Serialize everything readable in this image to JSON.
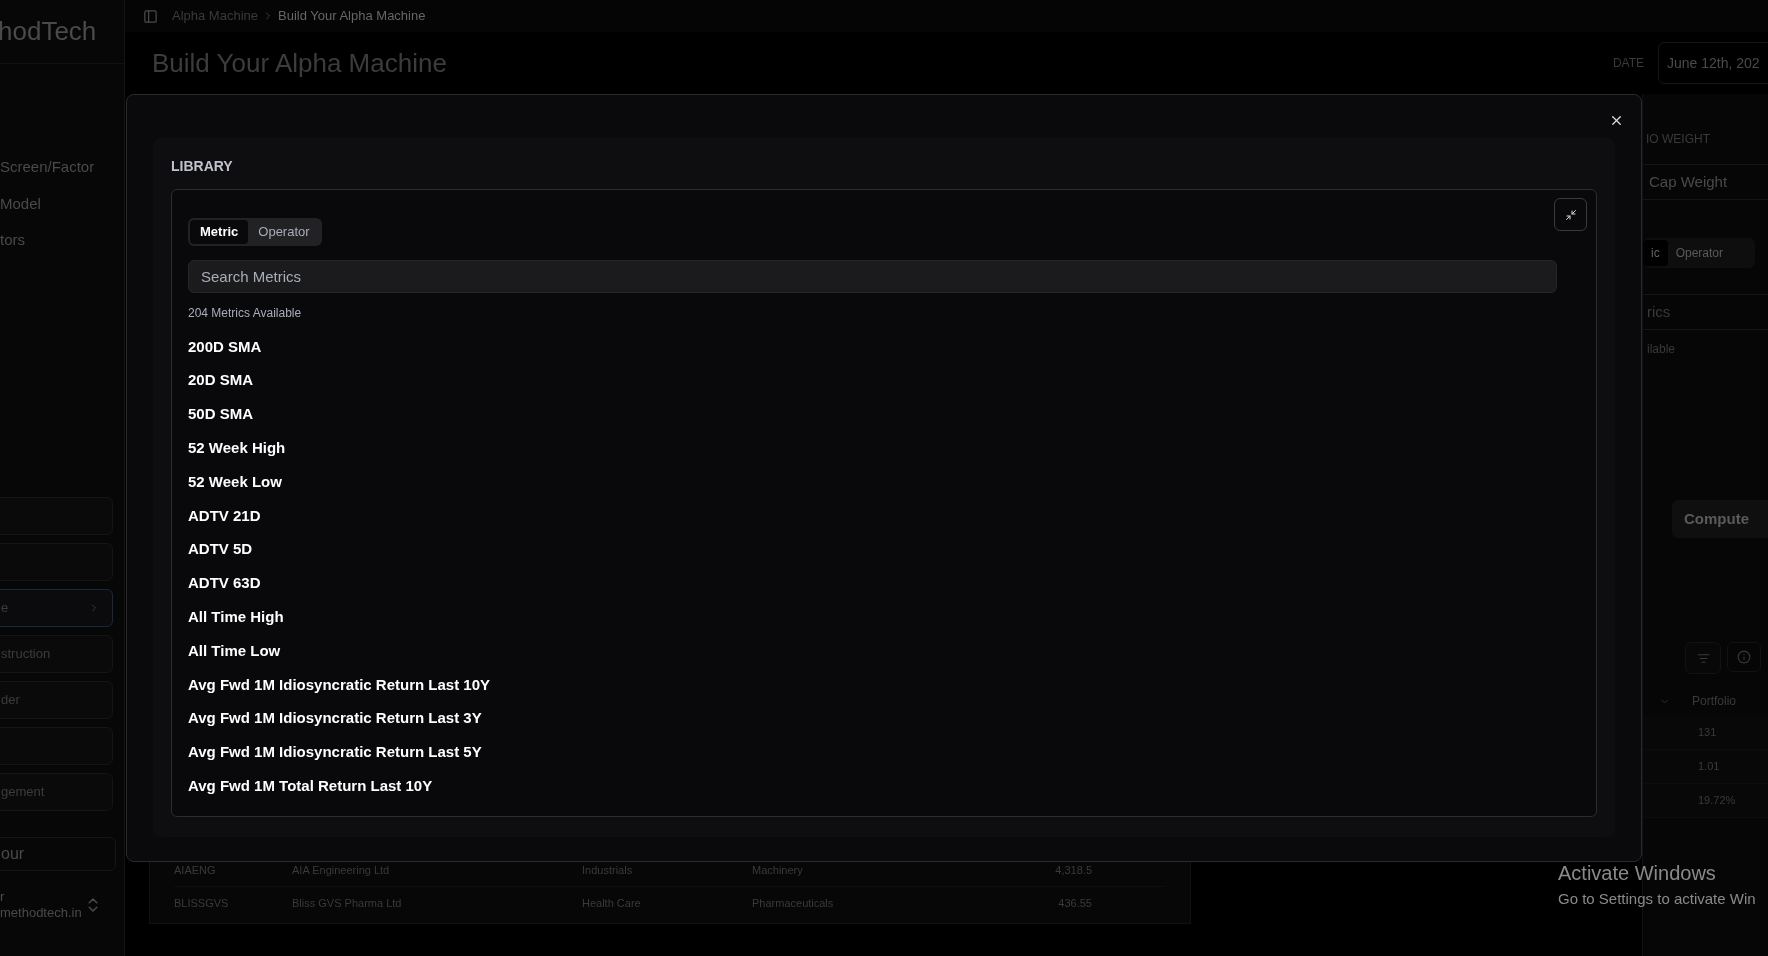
{
  "sidebar": {
    "logo": "hodTech",
    "nav": [
      {
        "label": "Screen/Factor"
      },
      {
        "label": "Model"
      },
      {
        "label": "tors"
      }
    ],
    "panels": [
      {
        "selected": false
      },
      {
        "selected": false
      },
      {
        "label": "e",
        "selected": true
      },
      {
        "label": "struction",
        "selected": false
      },
      {
        "label": "der",
        "selected": false
      },
      {
        "selected": false
      },
      {
        "label": "gement",
        "selected": false
      }
    ],
    "tour": "our",
    "user": {
      "name": "r",
      "email": "methodtech.in"
    }
  },
  "topbar": {
    "breadcrumb": [
      {
        "label": "Alpha Machine",
        "current": false
      },
      {
        "label": "Build Your Alpha Machine",
        "current": true
      }
    ]
  },
  "header": {
    "title": "Build Your Alpha Machine",
    "date_label": "DATE",
    "date_value": "June 12th, 202"
  },
  "right_panel": {
    "weight_label": "IO WEIGHT",
    "weight_value": "Cap Weight",
    "tabs": [
      {
        "label": "ic",
        "selected": true
      },
      {
        "label": "Operator",
        "selected": false
      }
    ],
    "search_placeholder": "rics",
    "count": "ilable",
    "compute": "Compute",
    "column": "Portfolio",
    "values": [
      "131",
      "1.01",
      "19.72%"
    ]
  },
  "table": {
    "rows": [
      [
        "AIAENG",
        "AIA Engineering Ltd",
        "Industrials",
        "Machinery",
        "4,318.5"
      ],
      [
        "BLISSGVS",
        "Bliss GVS Pharma Ltd",
        "Health Care",
        "Pharmaceuticals",
        "436.55"
      ]
    ]
  },
  "modal": {
    "section_title": "LIBRARY",
    "tabs": [
      {
        "label": "Metric",
        "selected": true
      },
      {
        "label": "Operator",
        "selected": false
      }
    ],
    "search": {
      "placeholder": "Search Metrics"
    },
    "count": "204 Metrics Available",
    "metrics": [
      "200D SMA",
      "20D SMA",
      "50D SMA",
      "52 Week High",
      "52 Week Low",
      "ADTV 21D",
      "ADTV 5D",
      "ADTV 63D",
      "All Time High",
      "All Time Low",
      "Avg Fwd 1M Idiosyncratic Return Last 10Y",
      "Avg Fwd 1M Idiosyncratic Return Last 3Y",
      "Avg Fwd 1M Idiosyncratic Return Last 5Y",
      "Avg Fwd 1M Total Return Last 10Y"
    ]
  },
  "os_notice": {
    "title": "Activate Windows",
    "text": "Go to Settings to activate Win"
  }
}
